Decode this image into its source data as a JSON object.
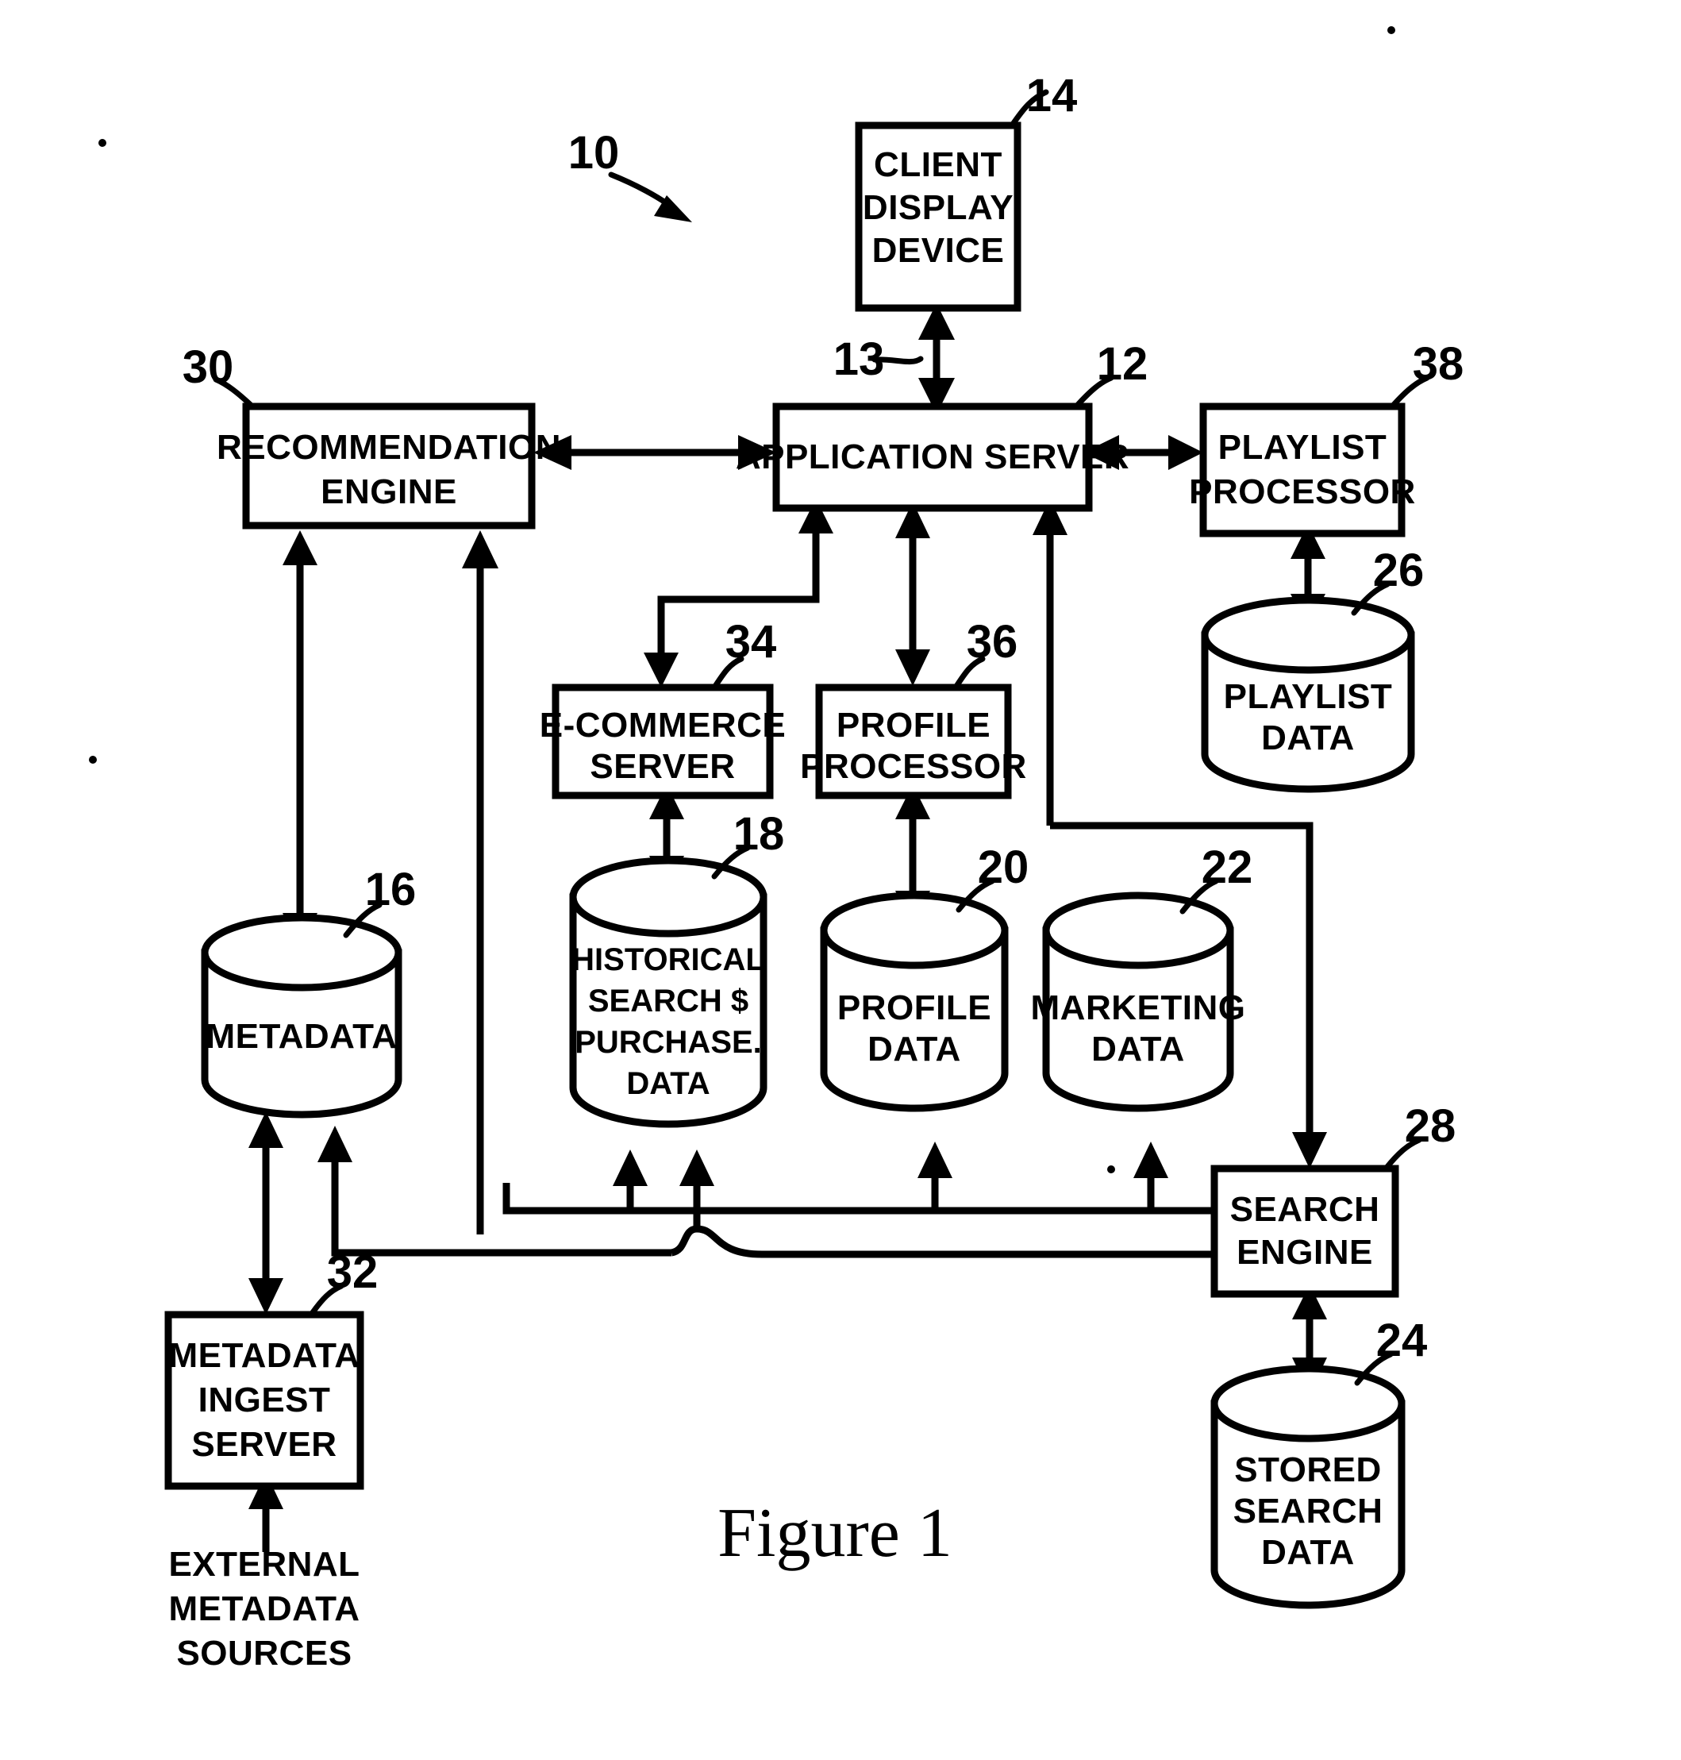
{
  "figure": {
    "caption": "Figure 1",
    "system_ref": "10"
  },
  "nodes": [
    {
      "id": "client_display_device",
      "kind": "box",
      "ref": "14",
      "lines": [
        "CLIENT",
        "DISPLAY",
        "DEVICE"
      ]
    },
    {
      "id": "application_server",
      "kind": "box",
      "ref": "12",
      "lines": [
        "APPLICATION SERVER"
      ]
    },
    {
      "id": "recommendation_engine",
      "kind": "box",
      "ref": "30",
      "lines": [
        "RECOMMENDATION",
        "ENGINE"
      ]
    },
    {
      "id": "playlist_processor",
      "kind": "box",
      "ref": "38",
      "lines": [
        "PLAYLIST",
        "PROCESSOR"
      ]
    },
    {
      "id": "ecommerce_server",
      "kind": "box",
      "ref": "34",
      "lines": [
        "E-COMMERCE",
        "SERVER"
      ]
    },
    {
      "id": "profile_processor",
      "kind": "box",
      "ref": "36",
      "lines": [
        "PROFILE",
        "PROCESSOR"
      ]
    },
    {
      "id": "playlist_data",
      "kind": "cylinder",
      "ref": "26",
      "lines": [
        "PLAYLIST",
        "DATA"
      ]
    },
    {
      "id": "metadata",
      "kind": "cylinder",
      "ref": "16",
      "lines": [
        "METADATA"
      ]
    },
    {
      "id": "historical_search_purchase_data",
      "kind": "cylinder",
      "ref": "18",
      "lines": [
        "HISTORICAL",
        "SEARCH $",
        "PURCHASE.",
        "DATA"
      ]
    },
    {
      "id": "profile_data",
      "kind": "cylinder",
      "ref": "20",
      "lines": [
        "PROFILE",
        "DATA"
      ]
    },
    {
      "id": "marketing_data",
      "kind": "cylinder",
      "ref": "22",
      "lines": [
        "MARKETING",
        "DATA"
      ]
    },
    {
      "id": "search_engine",
      "kind": "box",
      "ref": "28",
      "lines": [
        "SEARCH",
        "ENGINE"
      ]
    },
    {
      "id": "stored_search_data",
      "kind": "cylinder",
      "ref": "24",
      "lines": [
        "STORED",
        "SEARCH",
        "DATA"
      ]
    },
    {
      "id": "metadata_ingest_server",
      "kind": "box",
      "ref": "32",
      "lines": [
        "METADATA",
        "INGEST",
        "SERVER"
      ]
    },
    {
      "id": "external_metadata_sources",
      "kind": "text",
      "ref": "",
      "lines": [
        "EXTERNAL",
        "METADATA",
        "SOURCES"
      ]
    }
  ],
  "connections": [
    {
      "id": "client-to-appserver",
      "ref": "13",
      "type": "bidirectional"
    },
    {
      "id": "recommendation-to-appserver",
      "ref": "",
      "type": "bidirectional"
    },
    {
      "id": "appserver-to-playlistprocessor",
      "ref": "",
      "type": "bidirectional"
    },
    {
      "id": "playlistprocessor-to-playlistdata",
      "ref": "",
      "type": "bidirectional"
    },
    {
      "id": "appserver-to-ecommerce",
      "ref": "",
      "type": "directed"
    },
    {
      "id": "appserver-to-profileprocessor",
      "ref": "",
      "type": "bidirectional"
    },
    {
      "id": "searchengine-to-appserver",
      "ref": "",
      "type": "directed"
    },
    {
      "id": "ecommerce-to-historicaldata",
      "ref": "",
      "type": "bidirectional"
    },
    {
      "id": "profileprocessor-to-profiledata",
      "ref": "",
      "type": "bidirectional"
    },
    {
      "id": "metadata-to-recommendation",
      "ref": "",
      "type": "directed"
    },
    {
      "id": "bus-to-recommendation",
      "ref": "",
      "type": "directed"
    },
    {
      "id": "appserver-to-searchengine",
      "ref": "",
      "type": "directed"
    },
    {
      "id": "searchengine-to-storedsearch",
      "ref": "",
      "type": "bidirectional"
    },
    {
      "id": "ingest-to-metadata",
      "ref": "",
      "type": "bidirectional"
    },
    {
      "id": "externalsources-to-ingest",
      "ref": "",
      "type": "directed"
    },
    {
      "id": "bus-upper-feeds",
      "ref": "",
      "type": "directed"
    },
    {
      "id": "bus-lower-feeds",
      "ref": "",
      "type": "directed"
    }
  ],
  "ref_numbers": [
    "10",
    "12",
    "13",
    "14",
    "16",
    "18",
    "20",
    "22",
    "24",
    "26",
    "28",
    "30",
    "32",
    "34",
    "36",
    "38"
  ]
}
